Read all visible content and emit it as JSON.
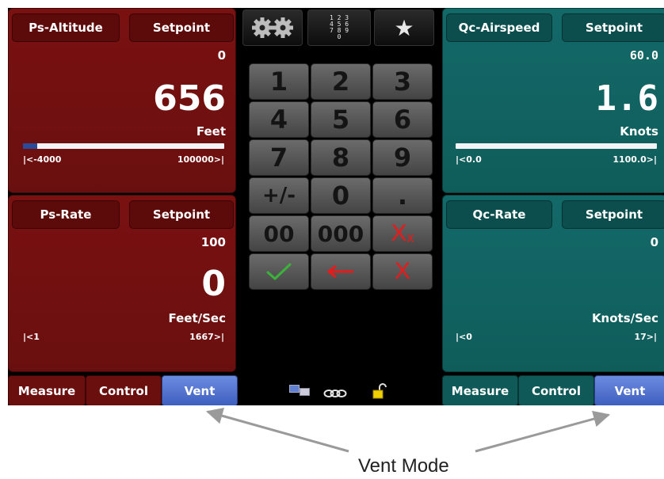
{
  "left_top": {
    "mode_label": "Ps-Altitude",
    "setpoint_label": "Setpoint",
    "setpoint_value": "0",
    "reading": "656",
    "unit": "Feet",
    "range_min": "|<-4000",
    "range_max": "100000>|",
    "bar_level": 0.07
  },
  "left_bottom": {
    "mode_label": "Ps-Rate",
    "setpoint_label": "Setpoint",
    "setpoint_value": "100",
    "reading": "0",
    "unit": "Feet/Sec",
    "range_min": "|<1",
    "range_max": "1667>|"
  },
  "right_top": {
    "mode_label": "Qc-Airspeed",
    "setpoint_label": "Setpoint",
    "setpoint_value": "60.0",
    "reading": "1.6",
    "unit": "Knots",
    "range_min": "|<0.0",
    "range_max": "1100.0>|",
    "bar_level": 0.0
  },
  "right_bottom": {
    "mode_label": "Qc-Rate",
    "setpoint_label": "Setpoint",
    "setpoint_value": "0",
    "reading": "",
    "unit": "Knots/Sec",
    "range_min": "|<0",
    "range_max": "17>|"
  },
  "top_icons": {
    "settings": "gear-icon",
    "keypad": "keypad-icon",
    "keypad_digits": [
      "1 2 3",
      "4 5 6",
      "7 8 9",
      "0"
    ],
    "favorites": "star-icon"
  },
  "keypad": {
    "k1": "1",
    "k2": "2",
    "k3": "3",
    "k4": "4",
    "k5": "5",
    "k6": "6",
    "k7": "7",
    "k8": "8",
    "k9": "9",
    "plusminus": "+/-",
    "k0": "0",
    "dot": ".",
    "k00": "00",
    "k000": "000",
    "clear": "X",
    "clear_sub": "x",
    "cancel": "X"
  },
  "bottom_left_tabs": {
    "measure": "Measure",
    "control": "Control",
    "vent": "Vent"
  },
  "bottom_right_tabs": {
    "measure": "Measure",
    "control": "Control",
    "vent": "Vent"
  },
  "status_icons": [
    "network-icon",
    "chain-icon",
    "unlock-icon"
  ],
  "callout": {
    "caption": "Vent Mode"
  },
  "colors": {
    "red_panel": "#6e1010",
    "teal_panel": "#126563",
    "vent_tab": "#4f6fcf",
    "check": "#3bb33b",
    "cancel": "#e81a1a"
  }
}
